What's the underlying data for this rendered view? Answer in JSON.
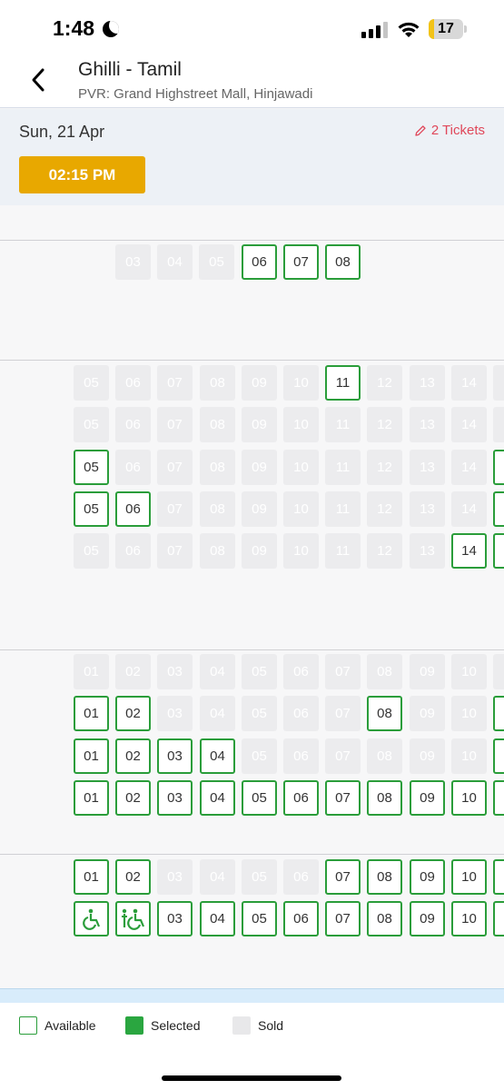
{
  "status_bar": {
    "time": "1:48",
    "battery": "17",
    "battery_level": 0.17
  },
  "header": {
    "title": "Ghilli - Tamil",
    "venue": "PVR: Grand Highstreet Mall, Hinjawadi"
  },
  "schedule": {
    "date": "Sun, 21 Apr",
    "tickets": "2 Tickets",
    "showtime": "02:15 PM"
  },
  "seat_rows": [
    {
      "seats": [
        {
          "n": "03",
          "s": "sold"
        },
        {
          "n": "04",
          "s": "sold"
        },
        {
          "n": "05",
          "s": "sold"
        },
        {
          "n": "06",
          "s": "available"
        },
        {
          "n": "07",
          "s": "available"
        },
        {
          "n": "08",
          "s": "available"
        }
      ]
    },
    {
      "seats": [
        {
          "n": "05",
          "s": "sold"
        },
        {
          "n": "06",
          "s": "sold"
        },
        {
          "n": "07",
          "s": "sold"
        },
        {
          "n": "08",
          "s": "sold"
        },
        {
          "n": "09",
          "s": "sold"
        },
        {
          "n": "10",
          "s": "sold"
        },
        {
          "n": "11",
          "s": "available"
        },
        {
          "n": "12",
          "s": "sold"
        },
        {
          "n": "13",
          "s": "sold"
        },
        {
          "n": "14",
          "s": "sold"
        },
        {
          "n": "",
          "s": "sold"
        }
      ]
    },
    {
      "seats": [
        {
          "n": "05",
          "s": "sold"
        },
        {
          "n": "06",
          "s": "sold"
        },
        {
          "n": "07",
          "s": "sold"
        },
        {
          "n": "08",
          "s": "sold"
        },
        {
          "n": "09",
          "s": "sold"
        },
        {
          "n": "10",
          "s": "sold"
        },
        {
          "n": "11",
          "s": "sold"
        },
        {
          "n": "12",
          "s": "sold"
        },
        {
          "n": "13",
          "s": "sold"
        },
        {
          "n": "14",
          "s": "sold"
        },
        {
          "n": "",
          "s": "sold"
        }
      ]
    },
    {
      "seats": [
        {
          "n": "05",
          "s": "available"
        },
        {
          "n": "06",
          "s": "sold"
        },
        {
          "n": "07",
          "s": "sold"
        },
        {
          "n": "08",
          "s": "sold"
        },
        {
          "n": "09",
          "s": "sold"
        },
        {
          "n": "10",
          "s": "sold"
        },
        {
          "n": "11",
          "s": "sold"
        },
        {
          "n": "12",
          "s": "sold"
        },
        {
          "n": "13",
          "s": "sold"
        },
        {
          "n": "14",
          "s": "sold"
        },
        {
          "n": "",
          "s": "available"
        }
      ]
    },
    {
      "seats": [
        {
          "n": "05",
          "s": "available"
        },
        {
          "n": "06",
          "s": "available"
        },
        {
          "n": "07",
          "s": "sold"
        },
        {
          "n": "08",
          "s": "sold"
        },
        {
          "n": "09",
          "s": "sold"
        },
        {
          "n": "10",
          "s": "sold"
        },
        {
          "n": "11",
          "s": "sold"
        },
        {
          "n": "12",
          "s": "sold"
        },
        {
          "n": "13",
          "s": "sold"
        },
        {
          "n": "14",
          "s": "sold"
        },
        {
          "n": "",
          "s": "available"
        }
      ]
    },
    {
      "seats": [
        {
          "n": "05",
          "s": "sold"
        },
        {
          "n": "06",
          "s": "sold"
        },
        {
          "n": "07",
          "s": "sold"
        },
        {
          "n": "08",
          "s": "sold"
        },
        {
          "n": "09",
          "s": "sold"
        },
        {
          "n": "10",
          "s": "sold"
        },
        {
          "n": "11",
          "s": "sold"
        },
        {
          "n": "12",
          "s": "sold"
        },
        {
          "n": "13",
          "s": "sold"
        },
        {
          "n": "14",
          "s": "available"
        },
        {
          "n": "",
          "s": "available"
        }
      ]
    },
    {
      "seats": [
        {
          "n": "01",
          "s": "sold"
        },
        {
          "n": "02",
          "s": "sold"
        },
        {
          "n": "03",
          "s": "sold"
        },
        {
          "n": "04",
          "s": "sold"
        },
        {
          "n": "05",
          "s": "sold"
        },
        {
          "n": "06",
          "s": "sold"
        },
        {
          "n": "07",
          "s": "sold"
        },
        {
          "n": "08",
          "s": "sold"
        },
        {
          "n": "09",
          "s": "sold"
        },
        {
          "n": "10",
          "s": "sold"
        },
        {
          "n": "",
          "s": "sold"
        }
      ]
    },
    {
      "seats": [
        {
          "n": "01",
          "s": "available"
        },
        {
          "n": "02",
          "s": "available"
        },
        {
          "n": "03",
          "s": "sold"
        },
        {
          "n": "04",
          "s": "sold"
        },
        {
          "n": "05",
          "s": "sold"
        },
        {
          "n": "06",
          "s": "sold"
        },
        {
          "n": "07",
          "s": "sold"
        },
        {
          "n": "08",
          "s": "available"
        },
        {
          "n": "09",
          "s": "sold"
        },
        {
          "n": "10",
          "s": "sold"
        },
        {
          "n": "",
          "s": "available"
        }
      ]
    },
    {
      "seats": [
        {
          "n": "01",
          "s": "available"
        },
        {
          "n": "02",
          "s": "available"
        },
        {
          "n": "03",
          "s": "available"
        },
        {
          "n": "04",
          "s": "available"
        },
        {
          "n": "05",
          "s": "sold"
        },
        {
          "n": "06",
          "s": "sold"
        },
        {
          "n": "07",
          "s": "sold"
        },
        {
          "n": "08",
          "s": "sold"
        },
        {
          "n": "09",
          "s": "sold"
        },
        {
          "n": "10",
          "s": "sold"
        },
        {
          "n": "",
          "s": "available"
        }
      ]
    },
    {
      "seats": [
        {
          "n": "01",
          "s": "available"
        },
        {
          "n": "02",
          "s": "available"
        },
        {
          "n": "03",
          "s": "available"
        },
        {
          "n": "04",
          "s": "available"
        },
        {
          "n": "05",
          "s": "available"
        },
        {
          "n": "06",
          "s": "available"
        },
        {
          "n": "07",
          "s": "available"
        },
        {
          "n": "08",
          "s": "available"
        },
        {
          "n": "09",
          "s": "available"
        },
        {
          "n": "10",
          "s": "available"
        },
        {
          "n": "",
          "s": "available"
        }
      ]
    },
    {
      "seats": [
        {
          "n": "01",
          "s": "available"
        },
        {
          "n": "02",
          "s": "available"
        },
        {
          "n": "03",
          "s": "sold"
        },
        {
          "n": "04",
          "s": "sold"
        },
        {
          "n": "05",
          "s": "sold"
        },
        {
          "n": "06",
          "s": "sold"
        },
        {
          "n": "07",
          "s": "available"
        },
        {
          "n": "08",
          "s": "available"
        },
        {
          "n": "09",
          "s": "available"
        },
        {
          "n": "10",
          "s": "available"
        },
        {
          "n": "",
          "s": "available"
        }
      ]
    },
    {
      "seats": [
        {
          "n": "",
          "s": "available",
          "icon": "wheelchair-icon"
        },
        {
          "n": "",
          "s": "available",
          "icon": "wheelchair-companion-icon"
        },
        {
          "n": "03",
          "s": "available"
        },
        {
          "n": "04",
          "s": "available"
        },
        {
          "n": "05",
          "s": "available"
        },
        {
          "n": "06",
          "s": "available"
        },
        {
          "n": "07",
          "s": "available"
        },
        {
          "n": "08",
          "s": "available"
        },
        {
          "n": "09",
          "s": "available"
        },
        {
          "n": "10",
          "s": "available"
        },
        {
          "n": "",
          "s": "available"
        }
      ]
    }
  ],
  "legend": {
    "available": "Available",
    "selected": "Selected",
    "sold": "Sold"
  },
  "colors": {
    "accent": "#E8A800",
    "available_border": "#2A9D3A",
    "selected": "#2AA640",
    "sold": "#ECECEE",
    "tickets": "#E0475A"
  }
}
